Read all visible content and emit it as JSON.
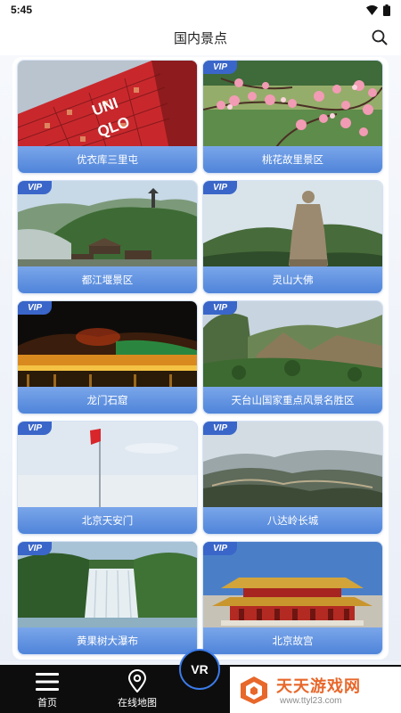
{
  "status": {
    "time": "5:45"
  },
  "header": {
    "title": "国内景点"
  },
  "vip_label": "VIP",
  "cards": [
    {
      "label": "优衣库三里屯",
      "vip": false
    },
    {
      "label": "桃花故里景区",
      "vip": true
    },
    {
      "label": "都江堰景区",
      "vip": true
    },
    {
      "label": "灵山大佛",
      "vip": true
    },
    {
      "label": "龙门石窟",
      "vip": true
    },
    {
      "label": "天台山国家重点风景名胜区",
      "vip": true
    },
    {
      "label": "北京天安门",
      "vip": true
    },
    {
      "label": "八达岭长城",
      "vip": true
    },
    {
      "label": "黄果树大瀑布",
      "vip": true
    },
    {
      "label": "北京故宫",
      "vip": true
    }
  ],
  "uniqlo": {
    "line1": "UNI",
    "line2": "QLO"
  },
  "nav": {
    "home": "首页",
    "map": "在线地图",
    "vr": "VR"
  },
  "watermark": {
    "title": "天天游戏网",
    "url": "www.ttyl23.com"
  },
  "colors": {
    "accent": "#4f84d9",
    "vip": "#3a66c9",
    "nav_bg": "#0d0d0d",
    "watermark": "#e8672a"
  }
}
